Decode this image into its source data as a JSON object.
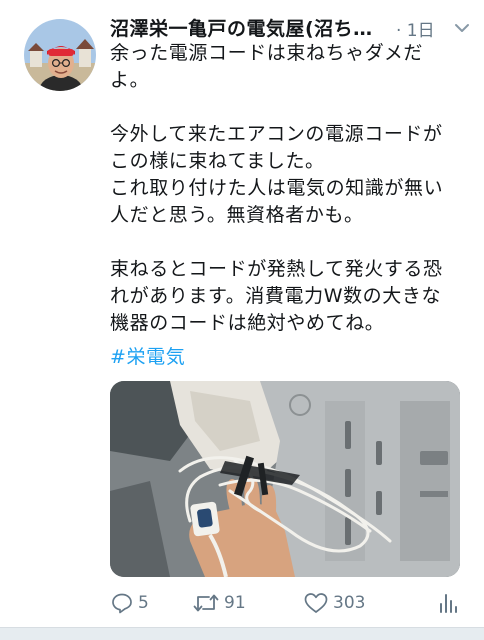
{
  "tweet": {
    "display_name": "沼澤栄一亀戸の電気屋(沼ち…",
    "timestamp": "· 1日",
    "text": "余った電源コードは束ねちゃダメだ\nよ。\n\n今外して来たエアコンの電源コードが\nこの様に束ねてました。\nこれ取り付けた人は電気の知識が無い\n人だと思う。無資格者かも。\n\n束ねるとコードが発熱して発火する恐\nれがあります。消費電力W数の大きな\n機器のコードは絶対やめてね。",
    "hashtag": "#栄電気"
  },
  "actions": {
    "reply_count": "5",
    "retweet_count": "91",
    "like_count": "303"
  },
  "icons": {
    "caret": "chevron-down-icon",
    "reply": "reply-icon",
    "retweet": "retweet-icon",
    "like": "heart-icon",
    "analytics": "analytics-icon"
  },
  "colors": {
    "text": "#14171a",
    "secondary": "#657786",
    "link": "#1da1f2"
  }
}
